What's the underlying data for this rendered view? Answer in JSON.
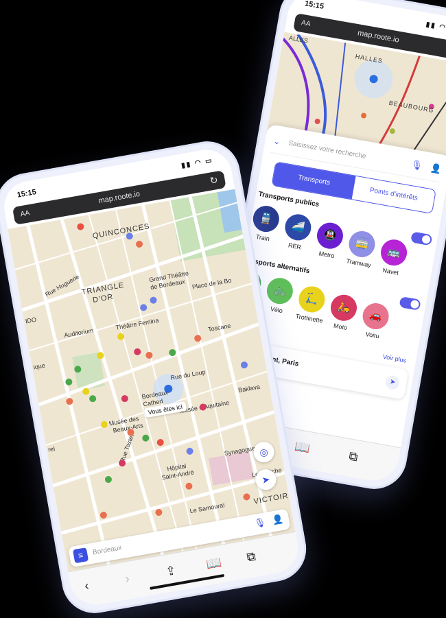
{
  "front": {
    "time": "15:15",
    "aa": "AA",
    "url": "map.roote.io",
    "places": [
      "QUINCONCES",
      "TRIANGLE",
      "D'OR",
      "Grand Théâtre",
      "de Bordeaux",
      "Place de la Bo",
      "Auditorium",
      "Théâtre Femina",
      "Toscane",
      "Rue Huguerie",
      "Bordeaux",
      "Cathed",
      "Musée des",
      "Beaux-Arts",
      "Musée d'Aquitaine",
      "Baklava",
      "Rue Tastet",
      "Hôpital",
      "Saint-André",
      "Synagogue",
      "Le Switche",
      "Le Samouraï",
      "VICTOIRE",
      "Rue du Loup",
      "IDO",
      "ique",
      "rel"
    ],
    "here_label": "Vous êtes ici",
    "search_placeholder": "Bordeaux",
    "menu_icon": "menu-icon",
    "mic_icon": "microphone-icon",
    "user_icon": "user-icon"
  },
  "back": {
    "time": "15:15",
    "aa": "AA",
    "url": "map.roote.io",
    "places": [
      "ALLES",
      "HALLES",
      "BEAUBOURG"
    ],
    "search_placeholder": "Saisissez votre recherche",
    "tabs": [
      "Transports",
      "Points d'intérêts"
    ],
    "public_title": "Transports publics",
    "public_modes": [
      {
        "label": "Train",
        "color": "#283b8f"
      },
      {
        "label": "RER",
        "color": "#2d49a8"
      },
      {
        "label": "Metro",
        "color": "#6b1fd1"
      },
      {
        "label": "Tramway",
        "color": "#8f8fe6"
      },
      {
        "label": "Navet",
        "color": "#b624d6"
      }
    ],
    "alt_title": "ransports alternatifs",
    "alt_modes": [
      {
        "label": "",
        "color": "#4aa84a"
      },
      {
        "label": "Vélo",
        "color": "#5fbf58"
      },
      {
        "label": "Trottinette",
        "color": "#e8d21c"
      },
      {
        "label": "Moto",
        "color": "#d63a62"
      },
      {
        "label": "Voitu",
        "color": "#e8738e"
      }
    ],
    "see_more": "Voir plus",
    "recent": "Saint-Laurent, Paris"
  }
}
